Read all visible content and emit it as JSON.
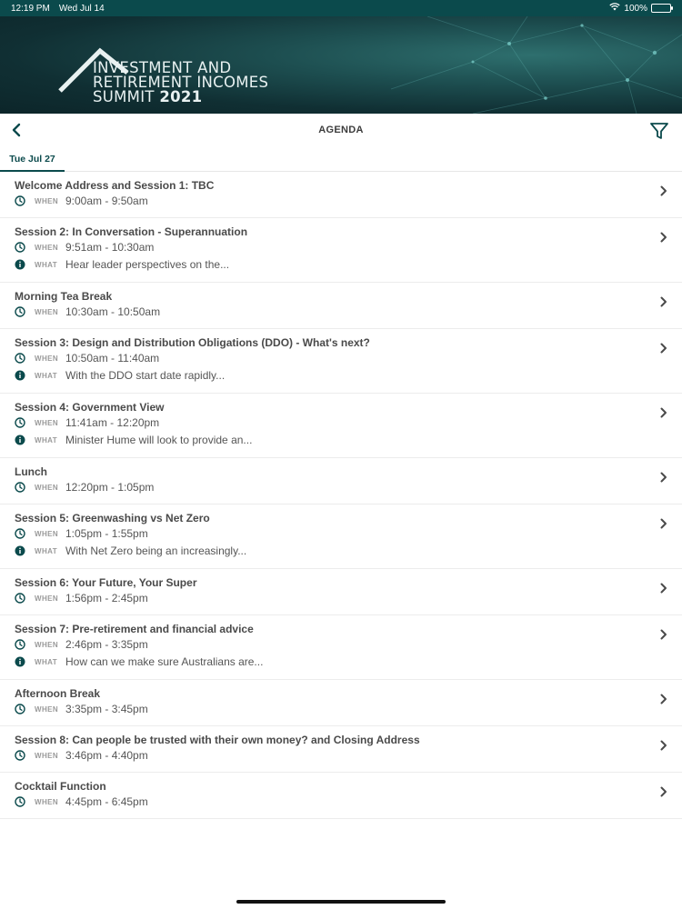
{
  "status_bar": {
    "time": "12:19 PM",
    "date": "Wed Jul 14",
    "battery": "100%"
  },
  "banner": {
    "title_line1": "INVESTMENT AND",
    "title_line2": "RETIREMENT INCOMES",
    "title_line3_prefix": "SUMMIT ",
    "title_year": "2021"
  },
  "nav": {
    "title": "AGENDA",
    "back_icon": "chevron-left-icon",
    "filter_icon": "filter-icon"
  },
  "tabs": [
    {
      "label": "Tue Jul 27",
      "active": true
    }
  ],
  "labels": {
    "when": "WHEN",
    "what": "WHAT"
  },
  "colors": {
    "accent": "#0b4a4c",
    "status_bar": "#0b4a4c"
  },
  "sessions": [
    {
      "title": "Welcome Address and Session 1: TBC",
      "when": "9:00am - 9:50am"
    },
    {
      "title": "Session 2: In Conversation - Superannuation",
      "when": "9:51am - 10:30am",
      "what": "Hear leader perspectives on the..."
    },
    {
      "title": "Morning Tea Break",
      "when": "10:30am - 10:50am"
    },
    {
      "title": "Session 3: Design and Distribution Obligations (DDO) - What's next?",
      "when": "10:50am - 11:40am",
      "what": "With the DDO start date rapidly..."
    },
    {
      "title": "Session 4: Government View",
      "when": "11:41am - 12:20pm",
      "what": "Minister Hume will look to provide an..."
    },
    {
      "title": "Lunch",
      "when": "12:20pm - 1:05pm"
    },
    {
      "title": "Session 5: Greenwashing vs Net Zero",
      "when": "1:05pm - 1:55pm",
      "what": "With Net Zero being an increasingly..."
    },
    {
      "title": "Session 6: Your Future, Your Super",
      "when": "1:56pm - 2:45pm"
    },
    {
      "title": "Session 7: Pre-retirement and financial advice",
      "when": "2:46pm - 3:35pm",
      "what": "How can we make sure Australians are..."
    },
    {
      "title": "Afternoon Break",
      "when": "3:35pm - 3:45pm"
    },
    {
      "title": "Session 8: Can people be trusted with their own money? and Closing Address",
      "when": "3:46pm - 4:40pm"
    },
    {
      "title": "Cocktail Function",
      "when": "4:45pm - 6:45pm"
    }
  ]
}
